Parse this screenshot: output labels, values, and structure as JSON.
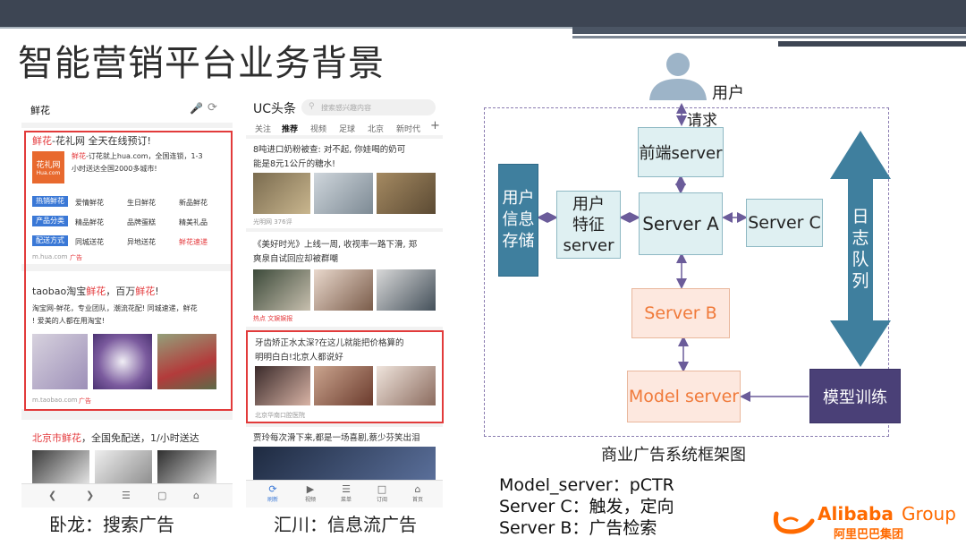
{
  "slide": {
    "title": "智能营销平台业务背景"
  },
  "search_phone": {
    "search_query": "鲜花",
    "ad1": {
      "title_highlight": "鲜花",
      "title_rest": "-花礼网 全天在线预订!",
      "logo_text": "花礼网",
      "logo_sub": "Hua.com",
      "desc_highlight": "鲜花",
      "desc_rest_1": "-订花就上hua.com，全国连锁，1-3",
      "desc_rest_2": "小时送达全国2000多城市!",
      "tags": [
        "热销鲜花",
        "产品分类",
        "配送方式"
      ],
      "row1": [
        "爱情鲜花",
        "生日鲜花",
        "新品鲜花"
      ],
      "row2": [
        "精品鲜花",
        "品牌蛋糕",
        "精美礼品"
      ],
      "row3": [
        "同城送花",
        "异地送花",
        "鲜花速递"
      ],
      "url": "m.hua.com",
      "ad_label": "广告"
    },
    "ad2": {
      "title_a": "taobao淘宝",
      "title_b": "鲜花",
      "title_c": "，百万",
      "title_d": "鲜花",
      "title_e": "!",
      "desc_1": "淘宝网-鲜花，专业团队，潮流花配! 同城速递，鲜花",
      "desc_2": "! 爱美的人都在用淘宝!",
      "url": "m.taobao.com",
      "ad_label": "广告"
    },
    "ad3": {
      "title_a": "北京市鲜花",
      "title_b": "，全国免配送，1/小时送达"
    },
    "caption": "卧龙：搜索广告"
  },
  "feed_phone": {
    "brand": "UC头条",
    "search_placeholder": "搜索感兴趣内容",
    "tabs": [
      "关注",
      "推荐",
      "视频",
      "足球",
      "北京",
      "新时代"
    ],
    "active_tab": "推荐",
    "item1_title_1": "8吨进口奶粉被查: 对不起, 你娃喝的奶可",
    "item1_title_2": "能是8元1公斤的糖水!",
    "item1_meta": "光明网  376评",
    "item2_title_1": "《美好时光》上线一周, 收视率一路下滑, 郑",
    "item2_title_2": "爽泉自试回应却被群嘲",
    "item2_meta": "热点  文娱娱报",
    "item3_title_1": "牙齿矫正水太深?在这儿就能把价格算的",
    "item3_title_2": "明明白白!北京人都说好",
    "item3_meta": "北京华南口腔医院",
    "item4_title": "贾玲每次滑下来,都是一场喜剧,蔡少芬笑出泪",
    "nav": [
      "刷新",
      "视频",
      "菜单",
      "订阅",
      "首页"
    ],
    "caption": "汇川：信息流广告"
  },
  "diagram": {
    "user_label": "用户",
    "request_label": "请求",
    "frontend": "前端server",
    "server_a": "Server A",
    "server_b": "Server B",
    "server_c": "Server C",
    "feature_server_1": "用户",
    "feature_server_2": "特征",
    "feature_server_3": "server",
    "storage_1": "用户",
    "storage_2": "信息",
    "storage_3": "存储",
    "log_queue": [
      "日",
      "志",
      "队",
      "列"
    ],
    "model_server": "Model server",
    "model_training": "模型训练",
    "caption": "商业广告系统框架图"
  },
  "legend": {
    "line1": "Model_server：pCTR",
    "line2": "Server C：触发，定向",
    "line3": "Server B：广告检索"
  },
  "logo": {
    "brand_en": "Alibaba",
    "brand_group": "Group",
    "brand_cn": "阿里巴巴集团"
  },
  "colors": {
    "highlight_red": "#e4393c",
    "box_cyan": "#dff0f2",
    "box_orange": "#fde8df",
    "box_navy": "#4a4077",
    "arrow_blue": "#3f7f9e",
    "alibaba_orange": "#ff6a00"
  }
}
